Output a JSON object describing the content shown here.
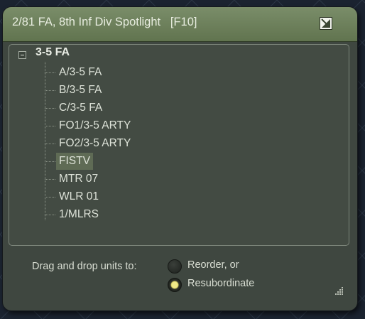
{
  "window": {
    "title": "2/81 FA, 8th Inf Div Spotlight   [F10]",
    "corner_icon": "restore-window-icon"
  },
  "tree": {
    "root": {
      "label": "3-5 FA",
      "expanded": true,
      "toggle_icon": "collapse-minus-icon"
    },
    "children": [
      {
        "label": "A/3-5 FA",
        "selected": false
      },
      {
        "label": "B/3-5 FA",
        "selected": false
      },
      {
        "label": "C/3-5 FA",
        "selected": false
      },
      {
        "label": "FO1/3-5 ARTY",
        "selected": false
      },
      {
        "label": "FO2/3-5 ARTY",
        "selected": false
      },
      {
        "label": "FISTV",
        "selected": true
      },
      {
        "label": "MTR 07",
        "selected": false
      },
      {
        "label": "WLR 01",
        "selected": false
      },
      {
        "label": "1/MLRS",
        "selected": false
      }
    ]
  },
  "footer": {
    "prompt": "Drag and drop units to:",
    "options": [
      {
        "label": "Reorder, or",
        "checked": false
      },
      {
        "label": "Resubordinate",
        "checked": true
      }
    ],
    "resize_icon": "resize-grip-icon"
  },
  "colors": {
    "titlebar": "#6b7e59",
    "panel": "#3f4740",
    "selection": "#5f6b55",
    "radio_checked": "#e8e27c"
  }
}
